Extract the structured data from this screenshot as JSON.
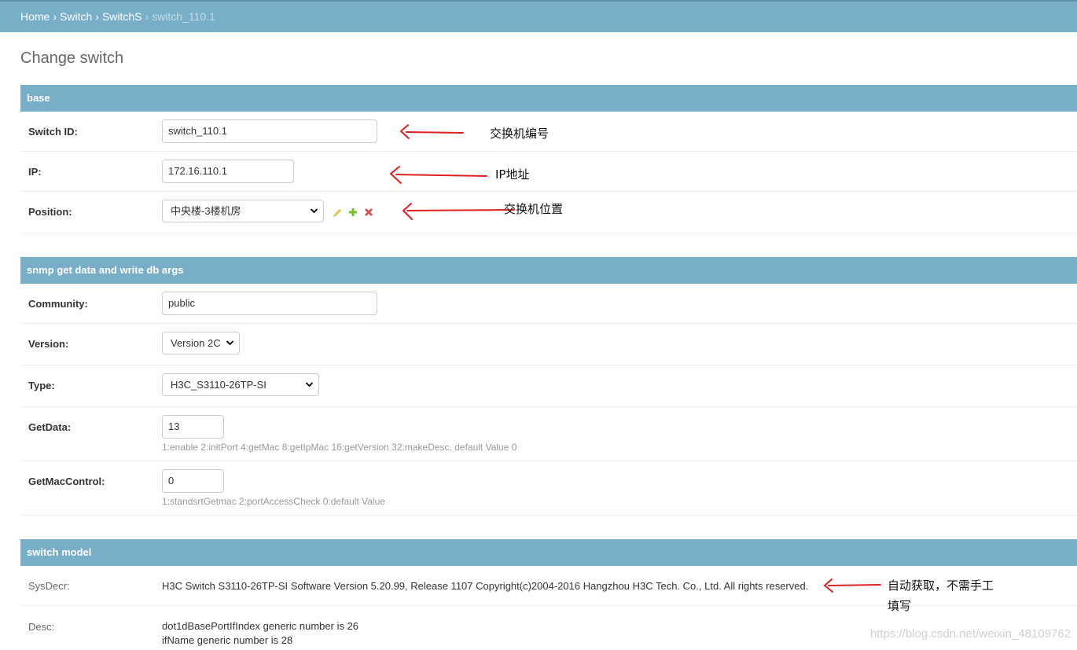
{
  "breadcrumbs": {
    "home": "Home",
    "app": "Switch",
    "model": "SwitchS",
    "current": "switch_110.1",
    "separator": "›"
  },
  "page_title": "Change switch",
  "fieldsets": {
    "base": {
      "title": "base",
      "switch_id": {
        "label": "Switch ID:",
        "value": "switch_110.1"
      },
      "ip": {
        "label": "IP:",
        "value": "172.16.110.1"
      },
      "position": {
        "label": "Position:",
        "value": "中央楼-3楼机房"
      }
    },
    "snmp": {
      "title": "snmp get data and write db args",
      "community": {
        "label": "Community:",
        "value": "public"
      },
      "version": {
        "label": "Version:",
        "value": "Version 2C"
      },
      "type": {
        "label": "Type:",
        "value": "H3C_S3110-26TP-SI"
      },
      "getdata": {
        "label": "GetData:",
        "value": "13",
        "help": "1:enable 2:initPort 4:getMac 8:getIpMac 16:getVersion 32:makeDesc, default Value 0"
      },
      "getmaccontrol": {
        "label": "GetMacControl:",
        "value": "0",
        "help": "1:standsrtGetmac 2:portAccessCheck 0:default Value"
      }
    },
    "model": {
      "title": "switch model",
      "sysdecr": {
        "label": "SysDecr:",
        "value": "H3C Switch S3110-26TP-SI Software Version 5.20.99, Release 1107 Copyright(c)2004-2016 Hangzhou H3C Tech. Co., Ltd. All rights reserved."
      },
      "desc": {
        "label": "Desc:",
        "line1": "dot1dBasePortIfIndex generic number is 26",
        "line2": "ifName generic number is 28"
      }
    }
  },
  "annotations": {
    "switch_id": "交换机编号",
    "ip": "IP地址",
    "position": "交换机位置",
    "sysdecr_line1": "自动获取，不需手工",
    "sysdecr_line2": "填写"
  },
  "watermark": "https://blog.csdn.net/weixin_48109762",
  "colors": {
    "header_bg": "#79aec8",
    "annotation_arrow": "#e02020",
    "edit_icon": "#e8c33a",
    "add_icon": "#70bf2b",
    "delete_icon": "#dd4646"
  },
  "icons": [
    "chevron-down-icon",
    "pencil-icon",
    "plus-icon",
    "close-icon",
    "arrow-left-icon"
  ]
}
